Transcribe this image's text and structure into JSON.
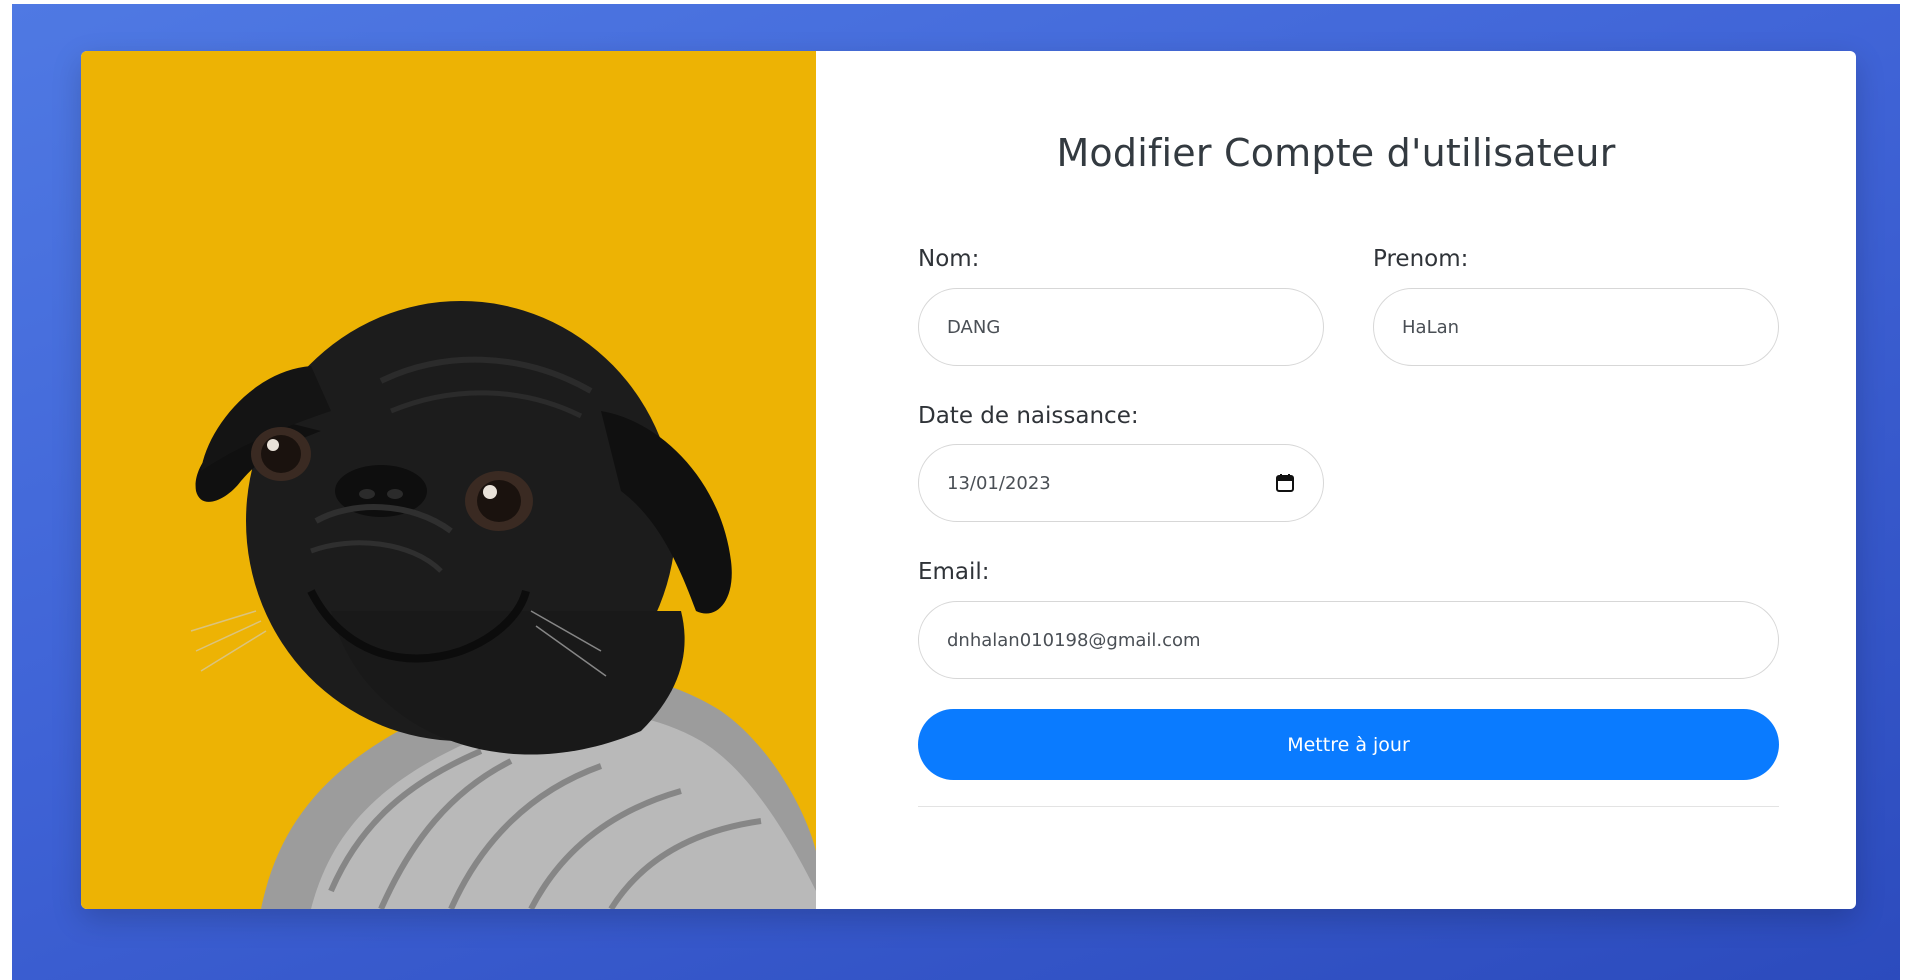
{
  "form": {
    "title": "Modifier Compte d'utilisateur",
    "fields": {
      "nom": {
        "label": "Nom:",
        "value": "DANG"
      },
      "prenom": {
        "label": "Prenom:",
        "value": "HaLan"
      },
      "date_naissance": {
        "label": "Date de naissance:",
        "value": "13/01/2023",
        "icon": "calendar-icon"
      },
      "email": {
        "label": "Email:",
        "value": "dnhalan010198@gmail.com"
      }
    },
    "submit_label": "Mettre à jour"
  },
  "colors": {
    "background_blue": "#4a6fe0",
    "photo_background": "#edb304",
    "button_blue": "#0a7bff",
    "text_dark": "#333a40"
  },
  "image": {
    "subject_icon": "pug-photo"
  }
}
